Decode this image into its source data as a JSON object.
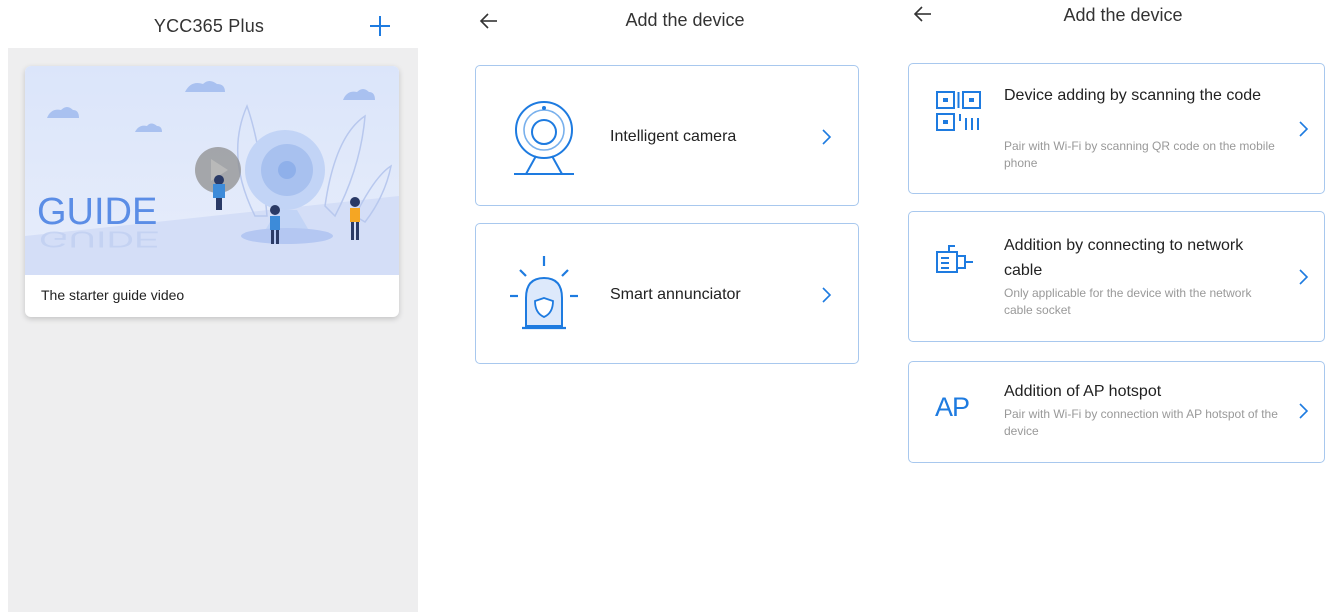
{
  "panel1": {
    "title": "YCC365  Plus",
    "guide_art_text": "GUIDE",
    "guide_card_label": "The starter guide video"
  },
  "panel2": {
    "title": "Add the device",
    "devices": [
      {
        "label": "Intelligent camera",
        "icon": "camera-icon"
      },
      {
        "label": "Smart annunciator",
        "icon": "alarm-icon"
      }
    ]
  },
  "panel3": {
    "title": "Add the device",
    "methods": [
      {
        "title": "Device adding by scanning the code",
        "desc": "Pair with Wi-Fi by scanning QR code on the mobile phone",
        "icon": "qr-code-icon"
      },
      {
        "title": "Addition by connecting to network cable",
        "desc": "Only applicable for the device with the network cable socket",
        "icon": "network-cable-icon"
      },
      {
        "title": "Addition of AP hotspot",
        "desc": "Pair with Wi-Fi by connection with AP hotspot of the device",
        "icon_text": "AP"
      }
    ]
  },
  "colors": {
    "accent": "#1e7be0",
    "card_border": "#a8c8ee",
    "list_background": "#eeeeef",
    "description_text": "#999999"
  }
}
